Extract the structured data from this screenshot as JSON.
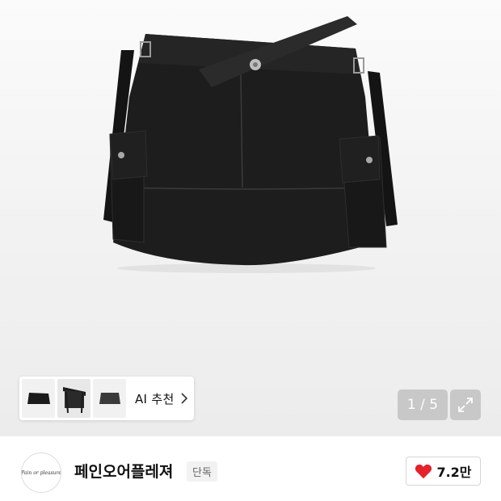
{
  "gallery": {
    "counter_text": "1 / 5",
    "ai_recommend_label": "AI 추천",
    "thumbnails": [
      "skirt-thumbnail-1",
      "belt-thumbnail",
      "skirt-thumbnail-2"
    ],
    "current_page": 1,
    "total_pages": 5
  },
  "brand": {
    "name": "페인오어플레져",
    "logo_text": "Pain or pleasure",
    "exclusive_badge": "단독"
  },
  "like": {
    "count": "7.2만",
    "heart_color": "#e8202a"
  },
  "icons": {
    "expand": "expand-arrows-icon",
    "chevron": "chevron-right-icon",
    "heart": "heart-icon"
  }
}
